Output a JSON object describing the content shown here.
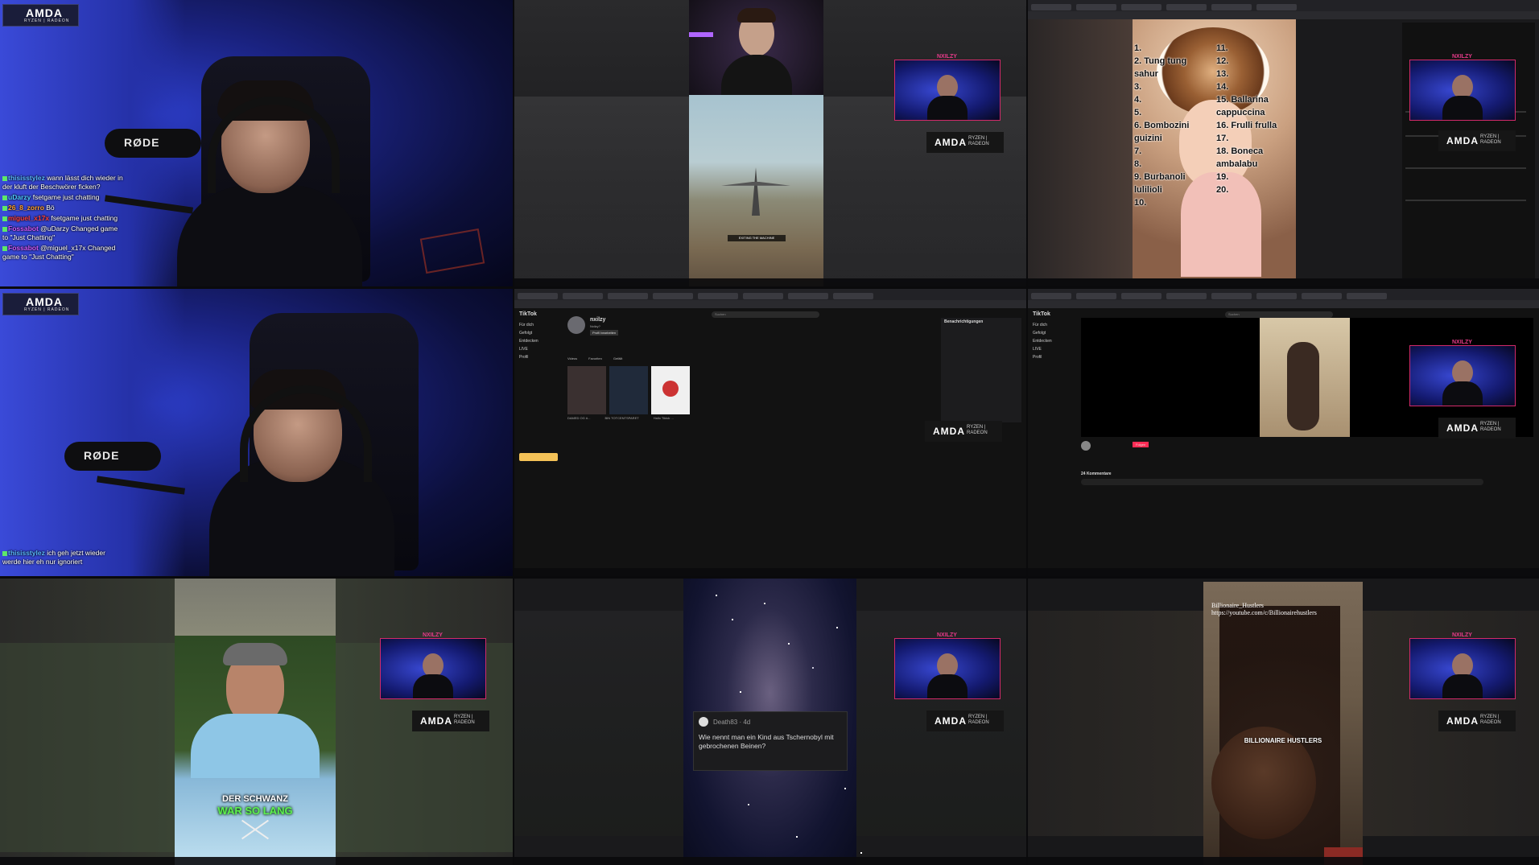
{
  "layout": "3x3 video wall",
  "brand": {
    "amd": "AMDA",
    "ryzen_radeon": "RYZEN | RADEON",
    "mic_brand": "RØDE",
    "pip_tag": "NXILZY"
  },
  "colors": {
    "cam_blue": "#2c3dc8",
    "pip_border": "#d22a6a",
    "chat_green": "#5ee86b",
    "chat_pink": "#ff4b8b"
  },
  "cell1": {
    "chat": [
      {
        "user": "thisisstylez",
        "user_color": "#5ab8ff",
        "msg": "wann lässt dich wieder in der kluft der Beschwörer ficken?"
      },
      {
        "user": "uDarzy",
        "user_color": "#4ec9ff",
        "msg": "fsetgame just chatting"
      },
      {
        "user": "26_8_zorro",
        "user_color": "#ff9f2e",
        "msg": "Bö"
      },
      {
        "user": "miguel_x17x",
        "user_color": "#ff4040",
        "msg": "fsetgame just chatting"
      },
      {
        "user": "Fossabot",
        "user_color": "#d05aff",
        "msg": "@uDarzy Changed game to \"Just Chatting\""
      },
      {
        "user": "Fossabot",
        "user_color": "#d05aff",
        "msg": "@miguel_x17x Changed game to \"Just Chatting\""
      }
    ]
  },
  "cell2": {
    "game_text": "EXITING THE MACHINE"
  },
  "cell3": {
    "rank_left": [
      "1.",
      "2. Tung tung sahur",
      "3.",
      "4.",
      "5.",
      "6. Bombozini guizini",
      "7.",
      "8.",
      "9. Burbanoli lulilioli",
      "10."
    ],
    "rank_right": [
      "11.",
      "12.",
      "13.",
      "14.",
      "15. Ballarina cappuccina",
      "16. Frulli frulla",
      "17.",
      "18. Boneca ambalabu",
      "19.",
      "20."
    ]
  },
  "cell4": {
    "chat": [
      {
        "user": "thisisstylez",
        "user_color": "#5ab8ff",
        "msg": "ich geh jetzt wieder werde hier eh nur ignoriert"
      }
    ]
  },
  "cell5": {
    "app": "TikTok",
    "profile_name": "nxilzy",
    "profile_sub": "Nxilzy?",
    "edit": "Profil bearbeiten",
    "tabs": [
      "Videos",
      "Favoriten",
      "Gefällt"
    ],
    "nav": [
      "Für dich",
      "Gefolgt",
      "Entdecken",
      "LIVE",
      "Profil"
    ],
    "notifications_title": "Benachrichtigungen",
    "search_placeholder": "Suchen",
    "videos": [
      "DAMED OG #...",
      "BIN TOTCENTSPARET",
      "Hallo Tiktok ..."
    ]
  },
  "cell6": {
    "app": "TikTok",
    "comments_label": "24 Kommentare",
    "follow_btn": "Folgen",
    "nav": [
      "Für dich",
      "Gefolgt",
      "Entdecken",
      "LIVE",
      "Profil"
    ],
    "search_placeholder": "Suchen"
  },
  "cell7": {
    "caption_line1": "DER SCHWANZ",
    "caption_line2": "WAR SO LANG"
  },
  "cell8": {
    "user": "Death83 · 4d",
    "post": "Wie nennt man ein Kind aus Tschernobyl mit gebrochenen Beinen?"
  },
  "cell9": {
    "watermark_line1": "Billionaire_Hustlers",
    "watermark_line2": "https://youtube.com/c/Billionairehustlers",
    "center_text": "BILLIONAIRE HUSTLERS"
  }
}
